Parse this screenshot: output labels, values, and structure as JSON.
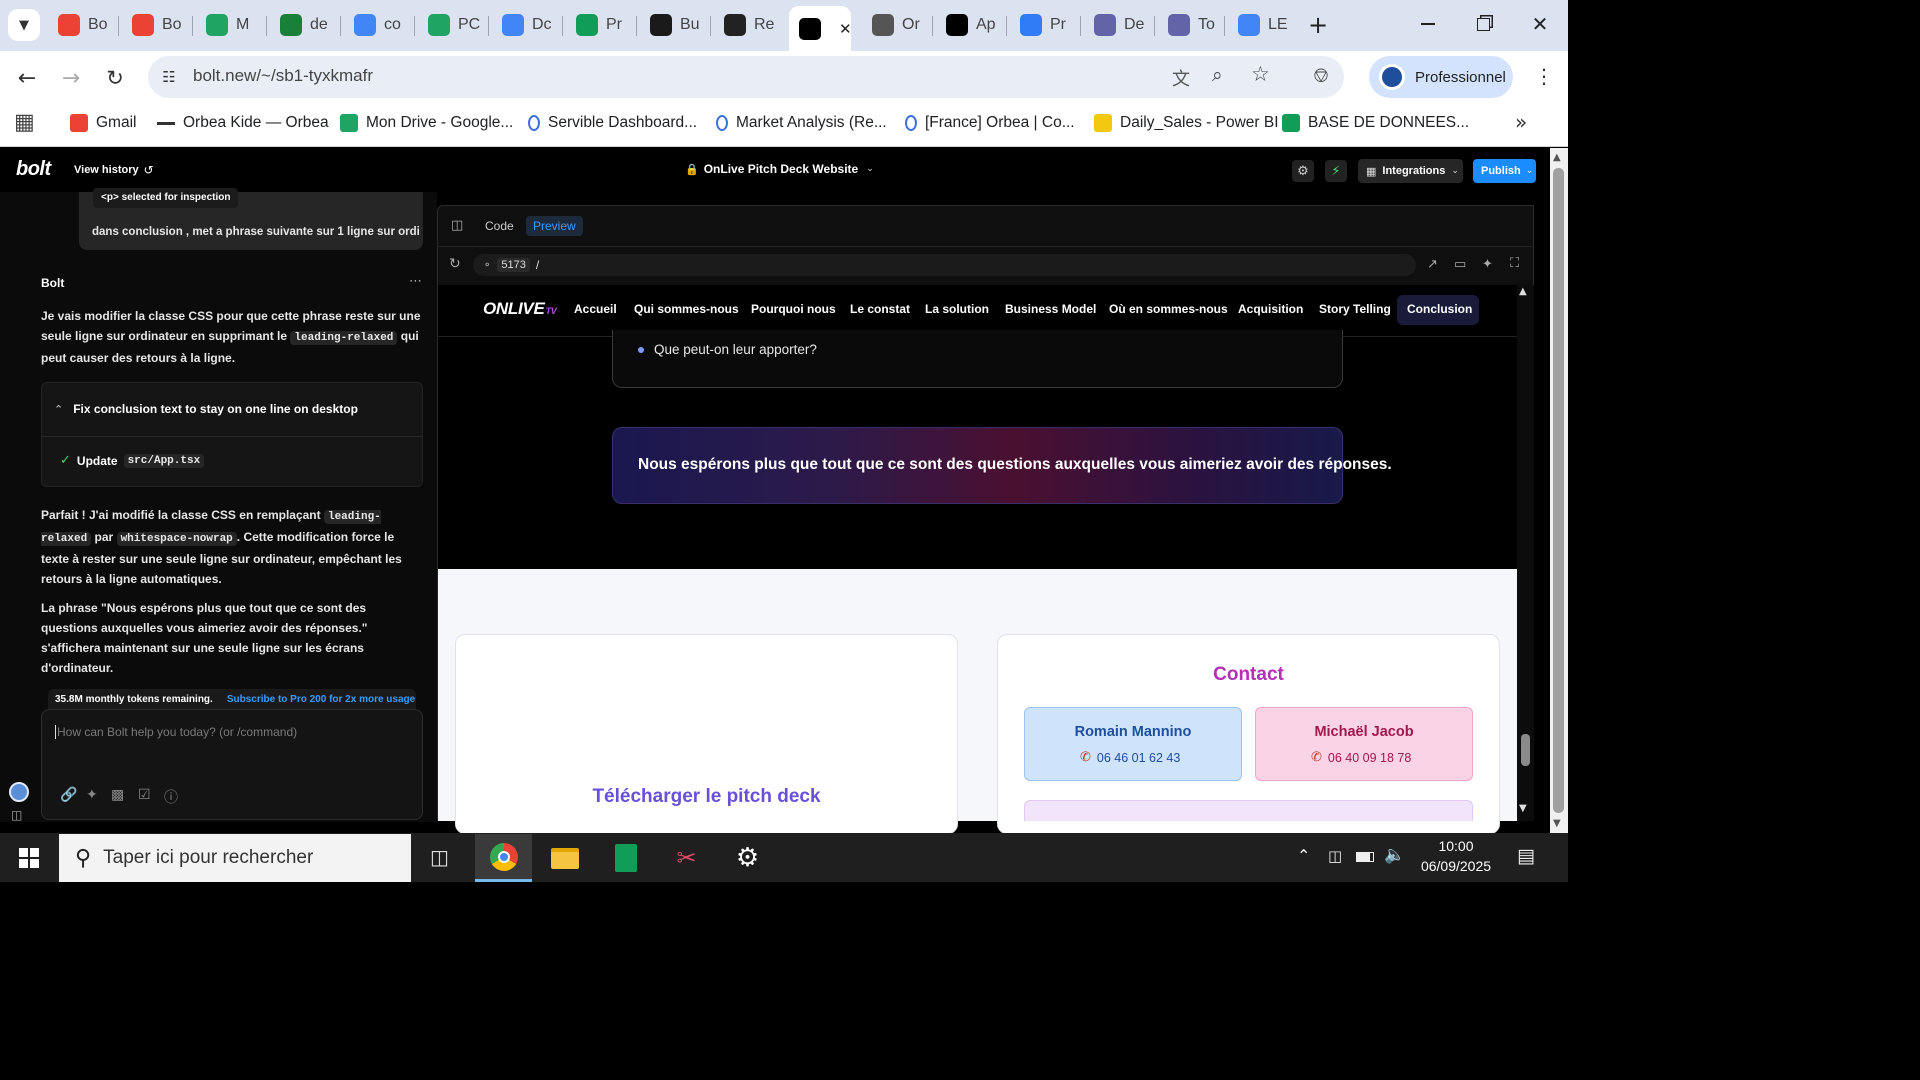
{
  "browser": {
    "tabs": [
      {
        "label": "Bo",
        "icon": "gmail-icon",
        "color": "#ea4335"
      },
      {
        "label": "Bo",
        "icon": "gmail-icon",
        "color": "#ea4335"
      },
      {
        "label": "M",
        "icon": "google-drive-icon",
        "color": "#1fa463"
      },
      {
        "label": "de",
        "icon": "plus-circle-icon",
        "color": "#188038"
      },
      {
        "label": "co",
        "icon": "lines-circle-icon",
        "color": "#4285f4"
      },
      {
        "label": "PC",
        "icon": "google-drive-icon",
        "color": "#1fa463"
      },
      {
        "label": "Dc",
        "icon": "google-docs-icon",
        "color": "#4285f4"
      },
      {
        "label": "Pr",
        "icon": "google-sheets-icon",
        "color": "#0f9d58"
      },
      {
        "label": "Bu",
        "icon": "bolt-app-icon",
        "color": "#1a1a1a"
      },
      {
        "label": "Re",
        "icon": "openai-icon",
        "color": "#222222"
      },
      {
        "label": "",
        "icon": "bolt-b-icon",
        "color": "#000000"
      },
      {
        "label": "Or",
        "icon": "globe-icon",
        "color": "#555555"
      },
      {
        "label": "Ap",
        "icon": "bolt-b-icon",
        "color": "#000000"
      },
      {
        "label": "Pr",
        "icon": "canva-icon",
        "color": "#2f7cf6"
      },
      {
        "label": "De",
        "icon": "teams-icon",
        "color": "#6264a7"
      },
      {
        "label": "To",
        "icon": "teams-icon",
        "color": "#6264a7"
      },
      {
        "label": "LE",
        "icon": "google-g-icon",
        "color": "#4285f4"
      }
    ],
    "url": "bolt.new/~/sb1-tyxkmafr",
    "profile_label": "Professionnel",
    "bookmarks": [
      {
        "label": "Gmail",
        "icon": "gmail-icon"
      },
      {
        "label": "Orbea Kide — Orbea",
        "icon": "dash-icon"
      },
      {
        "label": "Mon Drive - Google...",
        "icon": "google-drive-icon"
      },
      {
        "label": "Servible Dashboard...",
        "icon": "orbea-icon"
      },
      {
        "label": "Market Analysis (Re...",
        "icon": "orbea-icon"
      },
      {
        "label": "[France] Orbea | Co...",
        "icon": "orbea-icon"
      },
      {
        "label": "Daily_Sales - Power BI",
        "icon": "powerbi-icon"
      },
      {
        "label": "BASE DE DONNEES...",
        "icon": "google-sheets-icon"
      }
    ]
  },
  "bolt": {
    "logo": "bolt",
    "view_history": "View history",
    "project_title": "OnLive Pitch Deck Website",
    "integrations": "Integrations",
    "publish": "Publish",
    "selected_badge": "<p> selected for inspection",
    "user_message": "dans conclusion , met a phrase suivante sur 1 ligne sur ordi",
    "assistant_name": "Bolt",
    "reply1_a": "Je vais modifier la classe CSS pour que cette phrase reste sur une seule ligne sur ordinateur en supprimant le ",
    "reply1_code": "leading-relaxed",
    "reply1_b": " qui peut causer des retours à la ligne.",
    "action_title": "Fix conclusion text to stay on one line on desktop",
    "action_step": "Update",
    "action_file": "src/App.tsx",
    "reply2_a": "Parfait ! J'ai modifié la classe CSS en remplaçant ",
    "reply2_code1": "leading-relaxed",
    "reply2_b": " par ",
    "reply2_code2": "whitespace-nowrap",
    "reply2_c": ". Cette modification force le texte à rester sur une seule ligne sur ordinateur, empêchant les retours à la ligne automatiques.",
    "reply3": "La phrase \"Nous espérons plus que tout que ce sont des questions auxquelles vous aimeriez avoir des réponses.\" s'affichera maintenant sur une seule ligne sur les écrans d'ordinateur.",
    "tokens_left": "35.8M monthly tokens remaining.",
    "subscribe": "Subscribe to Pro 200 for 2x more usage",
    "input_placeholder": "How can Bolt help you today? (or /command)",
    "tab_code": "Code",
    "tab_preview": "Preview",
    "port": "5173",
    "path": "/"
  },
  "site": {
    "logo_main": "ONLIVE",
    "logo_sub": "TV",
    "nav": [
      "Accueil",
      "Qui sommes-nous",
      "Pourquoi nous",
      "Le constat",
      "La solution",
      "Business Model",
      "Où en sommes-nous",
      "Acquisition",
      "Story Telling",
      "Conclusion"
    ],
    "nav_active": "Conclusion",
    "bullet": "Que peut-on leur apporter?",
    "highlight": "Nous espérons plus que tout que ce sont des questions auxquelles vous aimeriez avoir des réponses.",
    "contact_title": "Contact",
    "contacts": [
      {
        "name": "Romain Mannino",
        "phone": "06 46 01 62 43"
      },
      {
        "name": "Michaël Jacob",
        "phone": "06 40 09 18 78"
      }
    ],
    "download_title": "Télécharger le pitch deck"
  },
  "taskbar": {
    "search_placeholder": "Taper ici pour rechercher",
    "time": "10:00",
    "date": "06/09/2025"
  },
  "colors": {
    "accent_blue": "#1a73e8",
    "publish_blue": "#1a8cff",
    "contact_purple": "#b42fb4",
    "download_purple": "#6a4fd8"
  }
}
